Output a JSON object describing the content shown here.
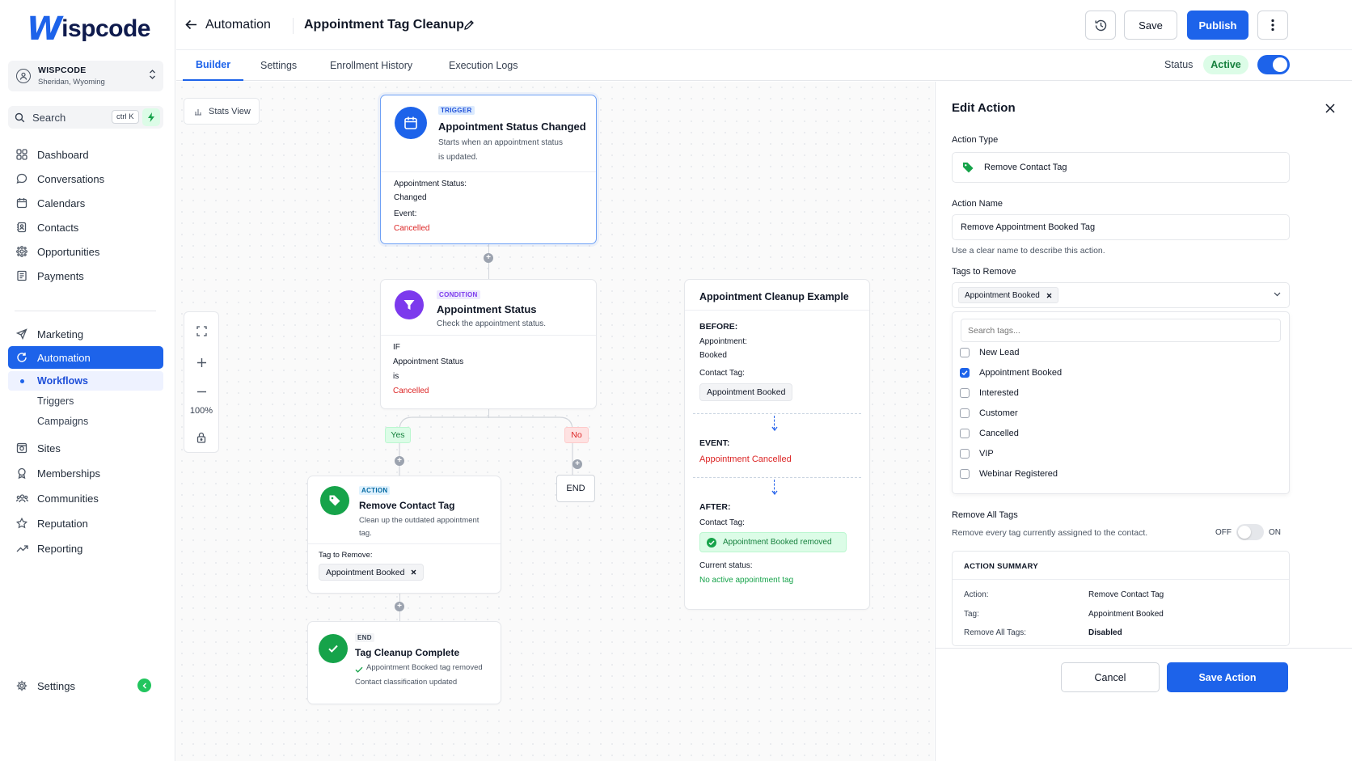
{
  "brand": {
    "logo_mark": "W",
    "logo_text": "ispcode",
    "accent": "#1d63ea",
    "success": "#16a34a",
    "danger": "#dc2626"
  },
  "account": {
    "name": "WISPCODE",
    "location": "Sheridan, Wyoming"
  },
  "search": {
    "label": "Search",
    "shortcut": "ctrl K"
  },
  "nav": [
    {
      "label": "Dashboard",
      "icon": "grid-icon"
    },
    {
      "label": "Conversations",
      "icon": "chat-icon"
    },
    {
      "label": "Calendars",
      "icon": "calendar-icon"
    },
    {
      "label": "Contacts",
      "icon": "contacts-icon"
    },
    {
      "label": "Opportunities",
      "icon": "opportunities-icon"
    },
    {
      "label": "Payments",
      "icon": "payments-icon"
    },
    {
      "label": "Marketing",
      "icon": "send-icon"
    },
    {
      "label": "Automation",
      "icon": "automation-icon"
    },
    {
      "label": "Sites",
      "icon": "sites-icon"
    },
    {
      "label": "Memberships",
      "icon": "memberships-icon"
    },
    {
      "label": "Communities",
      "icon": "communities-icon"
    },
    {
      "label": "Reputation",
      "icon": "star-icon"
    },
    {
      "label": "Reporting",
      "icon": "trend-icon"
    }
  ],
  "automation_sub": [
    "Workflows",
    "Triggers",
    "Campaigns"
  ],
  "settings_label": "Settings",
  "header": {
    "breadcrumb": "Automation",
    "workflow_title": "Appointment Tag Cleanup",
    "save": "Save",
    "publish": "Publish"
  },
  "tabs": [
    "Builder",
    "Settings",
    "Enrollment History",
    "Execution Logs"
  ],
  "status": {
    "label": "Status",
    "value": "Active"
  },
  "canvas": {
    "stats_view": "Stats View",
    "zoom_level": "100%",
    "trigger": {
      "tag": "TRIGGER",
      "title": "Appointment Status Changed",
      "desc1": "Starts when an appointment status",
      "desc2": "is updated.",
      "status_label": "Appointment Status:",
      "status_value": "Changed",
      "event_label": "Event:",
      "event_value": "Cancelled"
    },
    "condition": {
      "tag": "CONDITION",
      "title": "Appointment Status",
      "desc": "Check the appointment status.",
      "if": "IF",
      "field": "Appointment Status",
      "op": "is",
      "value": "Cancelled"
    },
    "yes": "Yes",
    "no": "No",
    "end": "END",
    "action": {
      "tag": "ACTION",
      "title": "Remove Contact Tag",
      "desc1": "Clean up the outdated appointment",
      "desc2": "tag.",
      "tag_label": "Tag to Remove:",
      "tag_value": "Appointment Booked"
    },
    "endnode": {
      "tag": "END",
      "title": "Tag Cleanup Complete",
      "line1": "Appointment Booked tag removed",
      "line2": "Contact classification updated"
    },
    "example": {
      "title": "Appointment Cleanup Example",
      "before": "BEFORE:",
      "appt_label": "Appointment:",
      "appt_value": "Booked",
      "tag_label": "Contact Tag:",
      "tag_value": "Appointment Booked",
      "event": "EVENT:",
      "event_value": "Appointment Cancelled",
      "after": "AFTER:",
      "after_tag_label": "Contact Tag:",
      "after_tag_value": "Appointment Booked removed",
      "current_label": "Current status:",
      "current_value": "No active appointment tag"
    }
  },
  "panel": {
    "title": "Edit Action",
    "action_type_label": "Action Type",
    "action_type": "Remove Contact Tag",
    "action_name_label": "Action Name",
    "action_name": "Remove Appointment Booked Tag",
    "action_name_help": "Use a clear name to describe this action.",
    "tags_label": "Tags to Remove",
    "selected_tag": "Appointment Booked",
    "search_placeholder": "Search tags...",
    "options": [
      {
        "label": "New Lead",
        "checked": false
      },
      {
        "label": "Appointment Booked",
        "checked": true
      },
      {
        "label": "Interested",
        "checked": false
      },
      {
        "label": "Customer",
        "checked": false
      },
      {
        "label": "Cancelled",
        "checked": false
      },
      {
        "label": "VIP",
        "checked": false
      },
      {
        "label": "Webinar Registered",
        "checked": false
      }
    ],
    "remove_all_label": "Remove All Tags",
    "remove_all_help": "Remove every tag currently assigned to the contact.",
    "off": "OFF",
    "on": "ON",
    "summary_title": "ACTION SUMMARY",
    "summary": [
      {
        "k": "Action:",
        "v": "Remove Contact Tag"
      },
      {
        "k": "Tag:",
        "v": "Appointment Booked"
      },
      {
        "k": "Remove All Tags:",
        "v": "Disabled"
      }
    ],
    "cancel": "Cancel",
    "save_action": "Save Action"
  }
}
